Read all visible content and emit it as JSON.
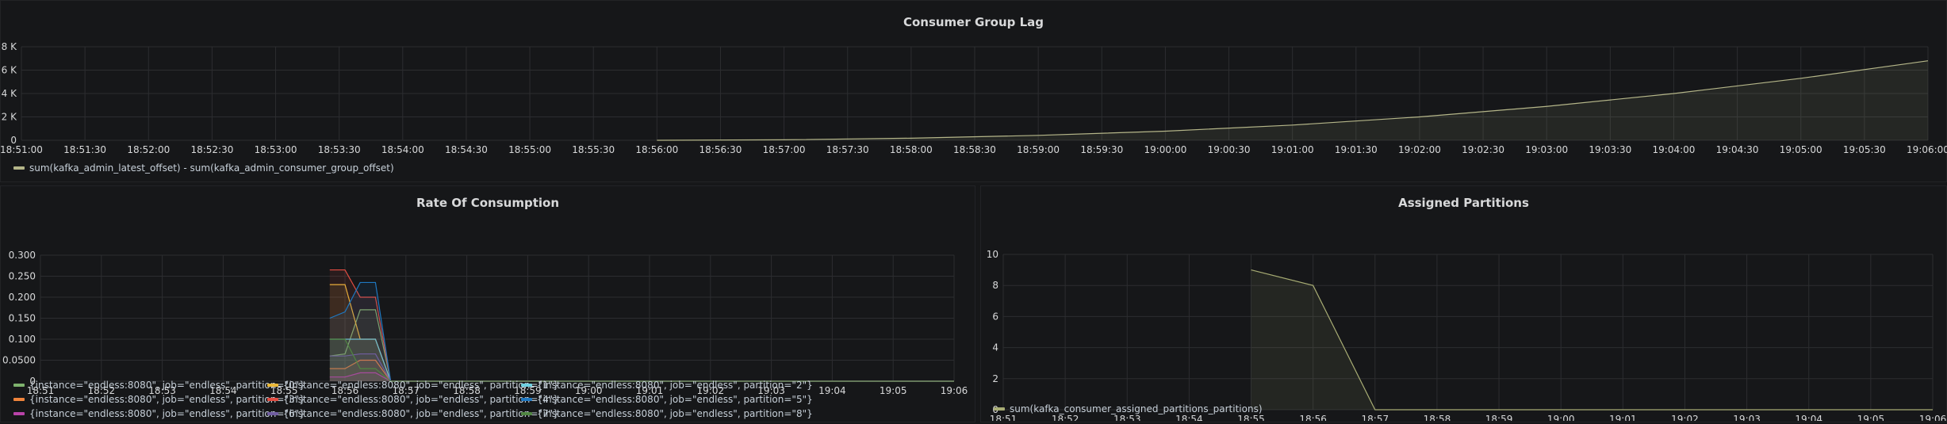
{
  "colors": {
    "grid": "#2c2d30",
    "axis_text": "#d8d9da",
    "series": [
      "#7eb26d",
      "#eab839",
      "#6ed0e0",
      "#ef843c",
      "#e24d42",
      "#1f78c1",
      "#ba43a9",
      "#705da0",
      "#508642"
    ],
    "lag_line": "#b5b689",
    "partitions_line": "#a8ad74"
  },
  "chart_data": [
    {
      "type": "area",
      "title": "Consumer Group Lag",
      "ylim": [
        0,
        8000
      ],
      "y_ticks": [
        "0",
        "2 K",
        "4 K",
        "6 K",
        "8 K"
      ],
      "y_tick_values": [
        0,
        2000,
        4000,
        6000,
        8000
      ],
      "x_ticks": [
        "18:51:00",
        "18:51:30",
        "18:52:00",
        "18:52:30",
        "18:53:00",
        "18:53:30",
        "18:54:00",
        "18:54:30",
        "18:55:00",
        "18:55:30",
        "18:56:00",
        "18:56:30",
        "18:57:00",
        "18:57:30",
        "18:58:00",
        "18:58:30",
        "18:59:00",
        "18:59:30",
        "19:00:00",
        "19:00:30",
        "19:01:00",
        "19:01:30",
        "19:02:00",
        "19:02:30",
        "19:03:00",
        "19:03:30",
        "19:04:00",
        "19:04:30",
        "19:05:00",
        "19:05:30",
        "19:06:00"
      ],
      "xlim": [
        "18:51:00",
        "19:06:00"
      ],
      "grid": true,
      "legend_position": "bottom",
      "series": [
        {
          "name": "sum(kafka_admin_latest_offset) - sum(kafka_admin_consumer_group_offset)",
          "x": [
            "18:56:00",
            "18:57:00",
            "18:58:00",
            "18:59:00",
            "19:00:00",
            "19:01:00",
            "19:02:00",
            "19:03:00",
            "19:04:00",
            "19:05:00",
            "19:06:00"
          ],
          "values": [
            0,
            40,
            180,
            420,
            780,
            1300,
            2000,
            2900,
            4000,
            5300,
            6800
          ]
        }
      ]
    },
    {
      "type": "area",
      "title": "Rate Of Consumption",
      "ylim": [
        0,
        0.3
      ],
      "y_ticks": [
        "0",
        "0.0500",
        "0.100",
        "0.150",
        "0.200",
        "0.250",
        "0.300"
      ],
      "y_tick_values": [
        0,
        0.05,
        0.1,
        0.15,
        0.2,
        0.25,
        0.3
      ],
      "x_ticks": [
        "18:51",
        "18:52",
        "18:53",
        "18:54",
        "18:55",
        "18:56",
        "18:57",
        "18:58",
        "18:59",
        "19:00",
        "19:01",
        "19:02",
        "19:03",
        "19:04",
        "19:05",
        "19:06"
      ],
      "xlim": [
        "18:51",
        "19:06"
      ],
      "grid": true,
      "legend_position": "bottom",
      "series": [
        {
          "name": "{instance=\"endless:8080\", job=\"endless\", partition=\"0\"}",
          "x": [
            "18:55:45",
            "18:56:00",
            "18:56:15",
            "18:56:30",
            "18:56:45",
            "18:57:00",
            "19:06:00"
          ],
          "values": [
            0.06,
            0.065,
            0.17,
            0.17,
            0,
            0,
            0
          ]
        },
        {
          "name": "{instance=\"endless:8080\", job=\"endless\", partition=\"1\"}",
          "x": [
            "18:55:45",
            "18:56:00",
            "18:56:15",
            "18:56:30",
            "18:56:45",
            "18:57:00",
            "19:06:00"
          ],
          "values": [
            0.23,
            0.23,
            0.1,
            0.1,
            0,
            0,
            0
          ]
        },
        {
          "name": "{instance=\"endless:8080\", job=\"endless\", partition=\"2\"}",
          "x": [
            "18:55:45",
            "18:56:00",
            "18:56:15",
            "18:56:30",
            "18:56:45",
            "18:57:00",
            "19:06:00"
          ],
          "values": [
            0.1,
            0.1,
            0.1,
            0.1,
            0,
            0,
            0
          ]
        },
        {
          "name": "{instance=\"endless:8080\", job=\"endless\", partition=\"3\"}",
          "x": [
            "18:55:45",
            "18:56:00",
            "18:56:15",
            "18:56:30",
            "18:56:45",
            "18:57:00",
            "19:06:00"
          ],
          "values": [
            0.03,
            0.03,
            0.05,
            0.05,
            0,
            0,
            0
          ]
        },
        {
          "name": "{instance=\"endless:8080\", job=\"endless\", partition=\"4\"}",
          "x": [
            "18:55:45",
            "18:56:00",
            "18:56:15",
            "18:56:30",
            "18:56:45",
            "18:57:00",
            "19:06:00"
          ],
          "values": [
            0.265,
            0.265,
            0.2,
            0.2,
            0,
            0,
            0
          ]
        },
        {
          "name": "{instance=\"endless:8080\", job=\"endless\", partition=\"5\"}",
          "x": [
            "18:55:45",
            "18:56:00",
            "18:56:15",
            "18:56:30",
            "18:56:45",
            "18:57:00",
            "19:06:00"
          ],
          "values": [
            0.15,
            0.165,
            0.235,
            0.235,
            0,
            0,
            0
          ]
        },
        {
          "name": "{instance=\"endless:8080\", job=\"endless\", partition=\"6\"}",
          "x": [
            "18:55:45",
            "18:56:00",
            "18:56:15",
            "18:56:30",
            "18:56:45",
            "18:57:00",
            "19:06:00"
          ],
          "values": [
            0.01,
            0.01,
            0.02,
            0.02,
            0,
            0,
            0
          ]
        },
        {
          "name": "{instance=\"endless:8080\", job=\"endless\", partition=\"7\"}",
          "x": [
            "18:55:45",
            "18:56:00",
            "18:56:15",
            "18:56:30",
            "18:56:45",
            "18:57:00",
            "19:06:00"
          ],
          "values": [
            0.06,
            0.06,
            0.065,
            0.065,
            0,
            0,
            0
          ]
        },
        {
          "name": "{instance=\"endless:8080\", job=\"endless\", partition=\"8\"}",
          "x": [
            "18:55:45",
            "18:56:00",
            "18:56:15",
            "18:56:30",
            "18:56:45",
            "18:57:00",
            "19:06:00"
          ],
          "values": [
            0.1,
            0.1,
            0.03,
            0.03,
            0,
            0,
            0
          ]
        }
      ]
    },
    {
      "type": "area",
      "title": "Assigned Partitions",
      "ylim": [
        0,
        10
      ],
      "y_ticks": [
        "0",
        "2",
        "4",
        "6",
        "8",
        "10"
      ],
      "y_tick_values": [
        0,
        2,
        4,
        6,
        8,
        10
      ],
      "x_ticks": [
        "18:51",
        "18:52",
        "18:53",
        "18:54",
        "18:55",
        "18:56",
        "18:57",
        "18:58",
        "18:59",
        "19:00",
        "19:01",
        "19:02",
        "19:03",
        "19:04",
        "19:05",
        "19:06"
      ],
      "xlim": [
        "18:51",
        "19:06"
      ],
      "grid": true,
      "legend_position": "bottom",
      "series": [
        {
          "name": "sum(kafka_consumer_assigned_partitions_partitions)",
          "x": [
            "18:55",
            "18:56",
            "18:57",
            "19:06"
          ],
          "values": [
            9,
            8,
            0,
            0
          ]
        }
      ]
    }
  ]
}
